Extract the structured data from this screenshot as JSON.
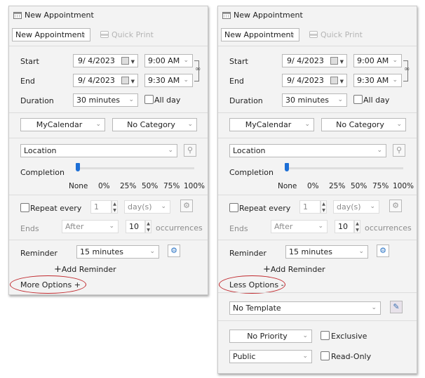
{
  "panels": {
    "left": {
      "title": "New Appointment",
      "type_select": "New Appointment",
      "quick_print": "Quick Print",
      "start_label": "Start",
      "start_date": "9/  4/2023",
      "start_time": "9:00 AM",
      "end_label": "End",
      "end_date": "9/  4/2023",
      "end_time": "9:30 AM",
      "duration_label": "Duration",
      "duration": "30 minutes",
      "all_day": "All day",
      "calendar": "MyCalendar",
      "category": "No Category",
      "location_placeholder": "Location",
      "completion_label": "Completion",
      "completion_value": "None",
      "completion_levels": [
        "None",
        "0%",
        "25%",
        "50%",
        "75%",
        "100%"
      ],
      "repeat_label": "Repeat every",
      "repeat_value": "1",
      "repeat_unit": "day(s)",
      "ends_label": "Ends",
      "ends_value": "After",
      "occurrences_value": "10",
      "occurrences_label": "occurrences",
      "reminder_label": "Reminder",
      "reminder_value": "15 minutes",
      "add_reminder": "Add Reminder",
      "toggle_options": "More Options +"
    },
    "right": {
      "title": "New Appointment",
      "type_select": "New Appointment",
      "quick_print": "Quick Print",
      "start_label": "Start",
      "start_date": "9/  4/2023",
      "start_time": "9:00 AM",
      "end_label": "End",
      "end_date": "9/  4/2023",
      "end_time": "9:30 AM",
      "duration_label": "Duration",
      "duration": "30 minutes",
      "all_day": "All day",
      "calendar": "MyCalendar",
      "category": "No Category",
      "location_placeholder": "Location",
      "completion_label": "Completion",
      "completion_value": "None",
      "completion_levels": [
        "None",
        "0%",
        "25%",
        "50%",
        "75%",
        "100%"
      ],
      "repeat_label": "Repeat every",
      "repeat_value": "1",
      "repeat_unit": "day(s)",
      "ends_label": "Ends",
      "ends_value": "After",
      "occurrences_value": "10",
      "occurrences_label": "occurrences",
      "reminder_label": "Reminder",
      "reminder_value": "15 minutes",
      "add_reminder": "Add Reminder",
      "toggle_options": "Less Options -",
      "template": "No Template",
      "priority": "No Priority",
      "exclusive": "Exclusive",
      "visibility": "Public",
      "read_only": "Read-Only"
    }
  },
  "icons": {
    "chevron": "⌄",
    "plus": "+",
    "gear": "⚙",
    "pin": "⚲",
    "link": "∞"
  },
  "colors": {
    "accent": "#1d6fd6",
    "highlight_ellipse": "#c0282d"
  }
}
